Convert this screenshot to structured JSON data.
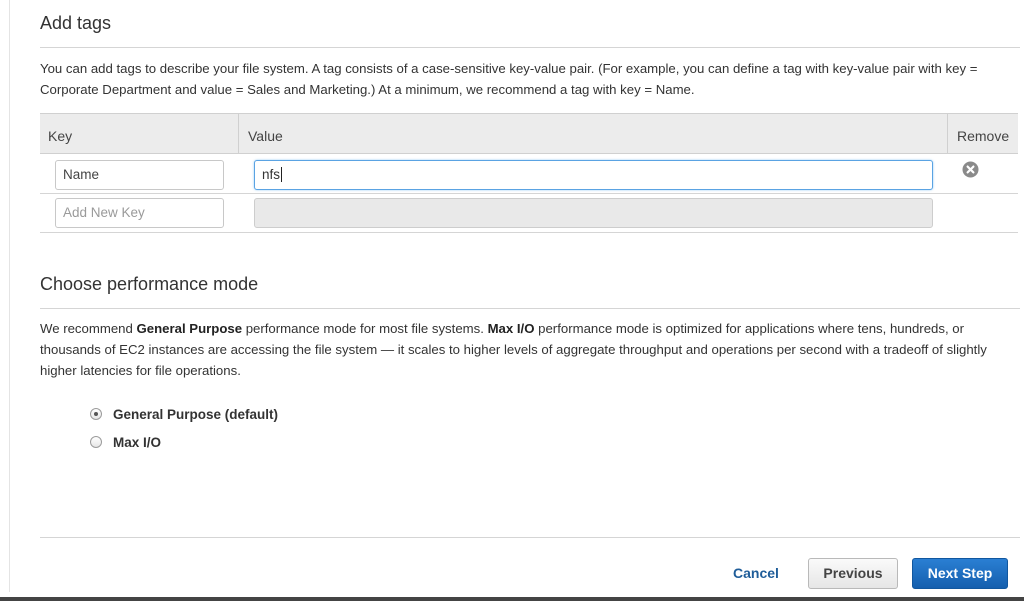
{
  "tags_section": {
    "title": "Add tags",
    "description": "You can add tags to describe your file system. A tag consists of a case-sensitive key-value pair. (For example, you can define a tag with key-value pair with key = Corporate Department and value = Sales and Marketing.) At a minimum, we recommend a tag with key = Name.",
    "table": {
      "headers": {
        "key": "Key",
        "value": "Value",
        "remove": "Remove"
      },
      "rows": [
        {
          "key": "Name",
          "value": "nfs"
        }
      ],
      "new_row": {
        "key_placeholder": "Add New Key",
        "value": ""
      }
    }
  },
  "performance_section": {
    "title": "Choose performance mode",
    "description": {
      "p1": "We recommend ",
      "b1": "General Purpose",
      "p2": " performance mode for most file systems. ",
      "b2": "Max I/O",
      "p3": " performance mode is optimized for applications where tens, hundreds, or thousands of EC2 instances are accessing the file system — it scales to higher levels of aggregate throughput and operations per second with a tradeoff of slightly higher latencies for file operations."
    },
    "options": [
      {
        "label": "General Purpose (default)",
        "selected": true
      },
      {
        "label": "Max I/O",
        "selected": false
      }
    ]
  },
  "footer": {
    "cancel_label": "Cancel",
    "previous_label": "Previous",
    "next_label": "Next Step"
  },
  "colors": {
    "primary_button": "#1a6cc2",
    "link": "#1f5d99",
    "focus_border": "#5aa3e3"
  },
  "icons": {
    "remove": "close-circle-icon"
  }
}
